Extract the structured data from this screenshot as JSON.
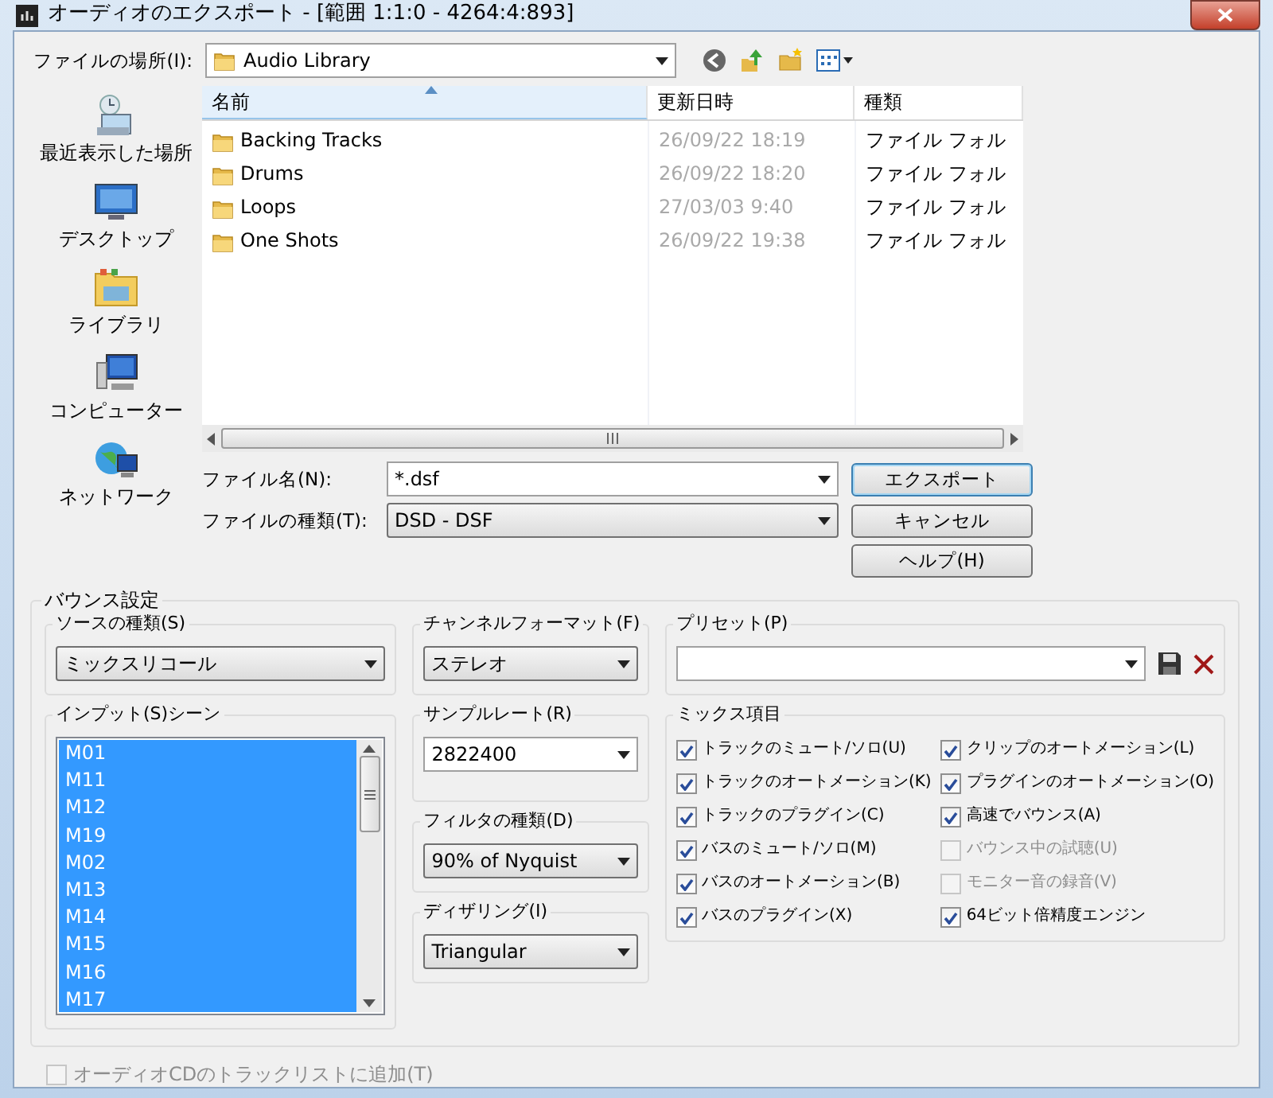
{
  "window": {
    "title": "オーディオのエクスポート - [範囲 1:1:0 - 4264:4:893]"
  },
  "location": {
    "label": "ファイルの場所(I):",
    "value": "Audio Library"
  },
  "places": [
    {
      "label": "最近表示した場所",
      "kind": "recent"
    },
    {
      "label": "デスクトップ",
      "kind": "desktop"
    },
    {
      "label": "ライブラリ",
      "kind": "library"
    },
    {
      "label": "コンピューター",
      "kind": "computer"
    },
    {
      "label": "ネットワーク",
      "kind": "network"
    }
  ],
  "file_list": {
    "columns": [
      {
        "label": "名前",
        "sorted": true
      },
      {
        "label": "更新日時",
        "sorted": false
      },
      {
        "label": "種類",
        "sorted": false
      }
    ],
    "rows": [
      {
        "name": "Backing Tracks",
        "modified": "26/09/22 18:19",
        "type": "ファイル フォル"
      },
      {
        "name": "Drums",
        "modified": "26/09/22 18:20",
        "type": "ファイル フォル"
      },
      {
        "name": "Loops",
        "modified": "27/03/03 9:40",
        "type": "ファイル フォル"
      },
      {
        "name": "One Shots",
        "modified": "26/09/22 19:38",
        "type": "ファイル フォル"
      }
    ]
  },
  "file_name": {
    "label": "ファイル名(N):",
    "value": "*.dsf"
  },
  "file_type": {
    "label": "ファイルの種類(T):",
    "value": "DSD - DSF"
  },
  "buttons": [
    {
      "label": "エクスポート",
      "default": true
    },
    {
      "label": "キャンセル",
      "default": false
    },
    {
      "label": "ヘルプ(H)",
      "default": false
    }
  ],
  "bounce": {
    "title": "バウンス設定",
    "source_type": {
      "label": "ソースの種類(S)",
      "value": "ミックスリコール"
    },
    "input_scene": {
      "label": "インプット(S)シーン",
      "items": [
        {
          "label": "M01",
          "selected": true
        },
        {
          "label": "M11",
          "selected": true
        },
        {
          "label": "M12",
          "selected": true
        },
        {
          "label": "M19",
          "selected": true
        },
        {
          "label": "M02",
          "selected": true
        },
        {
          "label": "M13",
          "selected": true
        },
        {
          "label": "M14",
          "selected": true
        },
        {
          "label": "M15",
          "selected": true
        },
        {
          "label": "M16",
          "selected": true
        },
        {
          "label": "M17",
          "selected": true
        }
      ]
    },
    "channel_format": {
      "label": "チャンネルフォーマット(F)",
      "value": "ステレオ"
    },
    "sample_rate": {
      "label": "サンプルレート(R)",
      "value": "2822400"
    },
    "filter_type": {
      "label": "フィルタの種類(D)",
      "value": "90% of Nyquist"
    },
    "dithering": {
      "label": "ディザリング(I)",
      "value": "Triangular"
    },
    "preset": {
      "label": "プリセット(P)"
    },
    "mix_items": {
      "label": "ミックス項目",
      "items": [
        {
          "label": "トラックのミュート/ソロ(U)",
          "checked": true,
          "disabled": false
        },
        {
          "label": "トラックのオートメーション(K)",
          "checked": true,
          "disabled": false
        },
        {
          "label": "トラックのプラグイン(C)",
          "checked": true,
          "disabled": false
        },
        {
          "label": "バスのミュート/ソロ(M)",
          "checked": true,
          "disabled": false
        },
        {
          "label": "バスのオートメーション(B)",
          "checked": true,
          "disabled": false
        },
        {
          "label": "バスのプラグイン(X)",
          "checked": true,
          "disabled": false
        },
        {
          "label": "クリップのオートメーション(L)",
          "checked": true,
          "disabled": false
        },
        {
          "label": "プラグインのオートメーション(O)",
          "checked": true,
          "disabled": false
        },
        {
          "label": "高速でバウンス(A)",
          "checked": true,
          "disabled": false
        },
        {
          "label": "バウンス中の試聴(U)",
          "checked": false,
          "disabled": true
        },
        {
          "label": "モニター音の録音(V)",
          "checked": false,
          "disabled": true
        },
        {
          "label": "64ビット倍精度エンジン",
          "checked": true,
          "disabled": false
        }
      ]
    }
  },
  "add_to_cd": {
    "label": "オーディオCDのトラックリストに追加(T)",
    "checked": false,
    "disabled": true
  }
}
